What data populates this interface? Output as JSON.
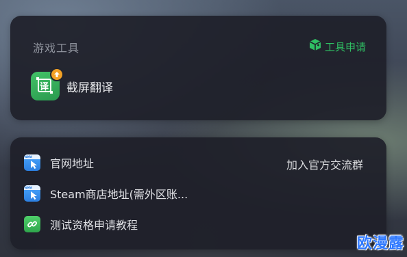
{
  "tools_section": {
    "title": "游戏工具",
    "apply_label": "工具申请",
    "items": [
      {
        "label": "截屏翻译",
        "icon": "screenshot-translate-icon",
        "icon_glyph": "译"
      }
    ]
  },
  "links_section": {
    "join_group_label": "加入官方交流群",
    "items": [
      {
        "label": "官网地址",
        "icon": "www-icon",
        "icon_text": "www"
      },
      {
        "label": "Steam商店地址(需外区账...",
        "icon": "www-icon",
        "icon_text": "www"
      },
      {
        "label": "测试资格申请教程",
        "icon": "link-icon"
      }
    ]
  },
  "watermark": {
    "text": "欧漫露"
  },
  "colors": {
    "accent_green": "#2fbf63",
    "card_bg": "#1e2029",
    "badge_orange": "#f3a125",
    "link_blue": "#2c7fe0"
  }
}
